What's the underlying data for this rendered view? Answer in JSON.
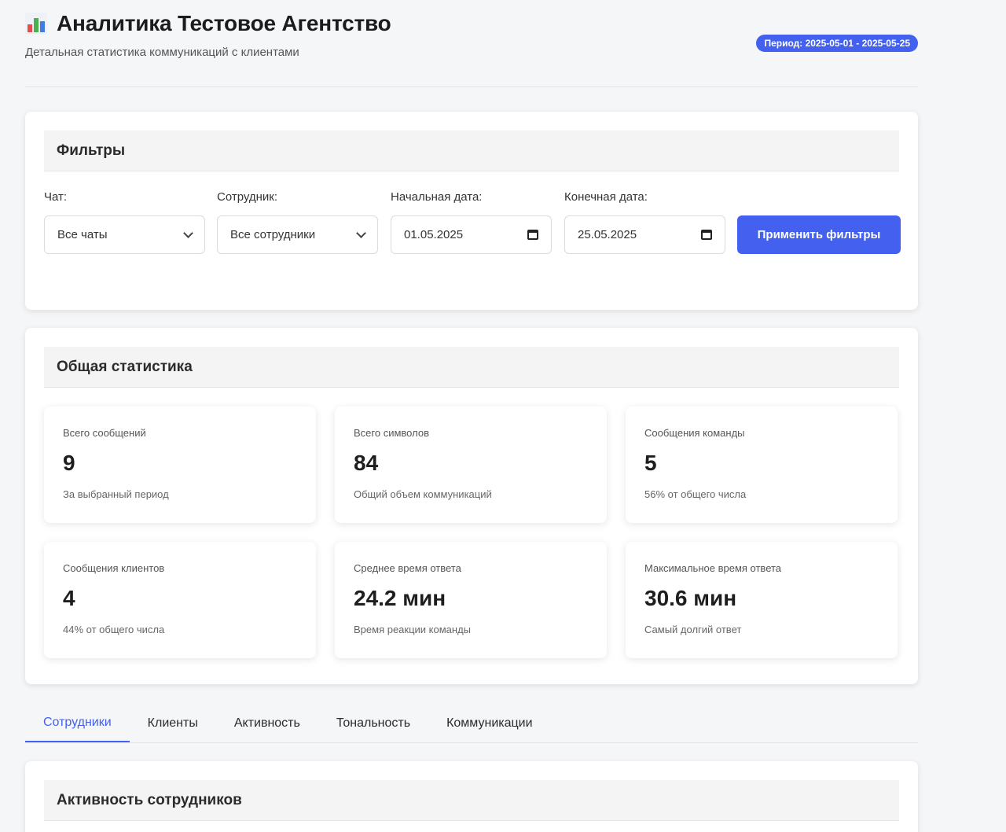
{
  "header": {
    "icon": "bar-chart-icon",
    "title": "Аналитика Тестовое Агентство",
    "subtitle": "Детальная статистика коммуникаций с клиентами",
    "period_badge": "Период: 2025-05-01 - 2025-05-25"
  },
  "filters": {
    "title": "Фильтры",
    "chat": {
      "label": "Чат:",
      "value": "Все чаты"
    },
    "employee": {
      "label": "Сотрудник:",
      "value": "Все сотрудники"
    },
    "start_date": {
      "label": "Начальная дата:",
      "value": "01.05.2025"
    },
    "end_date": {
      "label": "Конечная дата:",
      "value": "25.05.2025"
    },
    "apply_label": "Применить фильтры"
  },
  "stats": {
    "title": "Общая статистика",
    "cards": [
      {
        "label": "Всего сообщений",
        "value": "9",
        "note": "За выбранный период"
      },
      {
        "label": "Всего символов",
        "value": "84",
        "note": "Общий объем коммуникаций"
      },
      {
        "label": "Сообщения команды",
        "value": "5",
        "note": "56% от общего числа"
      },
      {
        "label": "Сообщения клиентов",
        "value": "4",
        "note": "44% от общего числа"
      },
      {
        "label": "Среднее время ответа",
        "value": "24.2 мин",
        "note": "Время реакции команды"
      },
      {
        "label": "Максимальное время ответа",
        "value": "30.6 мин",
        "note": "Самый долгий ответ"
      }
    ]
  },
  "tabs": [
    {
      "label": "Сотрудники",
      "active": true
    },
    {
      "label": "Клиенты"
    },
    {
      "label": "Активность"
    },
    {
      "label": "Тональность"
    },
    {
      "label": "Коммуникации"
    }
  ],
  "staff_activity": {
    "title": "Активность сотрудников"
  },
  "colors": {
    "accent": "#4361ee",
    "background": "#f5f6f8"
  }
}
